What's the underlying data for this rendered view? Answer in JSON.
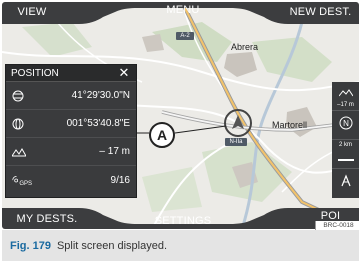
{
  "buttons": {
    "view": "VIEW",
    "menu": "MENU",
    "new_dest": "NEW DEST.",
    "my_dests": "MY DESTS.",
    "settings": "SETTINGS",
    "poi": "POI"
  },
  "map_labels": {
    "town1": "Abrera",
    "town2": "Martorell",
    "road1": "A-2",
    "road2": "N-IIa"
  },
  "position_panel": {
    "title": "POSITION",
    "close_icon": "close-icon",
    "rows": [
      {
        "icon": "latitude-icon",
        "value": "41°29'30.0\"N"
      },
      {
        "icon": "longitude-icon",
        "value": "001°53'40.8\"E"
      },
      {
        "icon": "altitude-icon",
        "value": "– 17 m"
      },
      {
        "icon": "gps-satellite-icon",
        "value": "9/16"
      }
    ],
    "gps_label": "GPS"
  },
  "right_strip": {
    "altitude_value": "–17 m",
    "scale_value": "2 km"
  },
  "callout": "A",
  "ref_code": "BRC-0018",
  "caption": {
    "label": "Fig. 179",
    "text": "Split screen displayed."
  },
  "colors": {
    "panel": "#3a3b3d",
    "map_bg": "#e9e9e6",
    "caption_accent": "#1a6aa0"
  }
}
